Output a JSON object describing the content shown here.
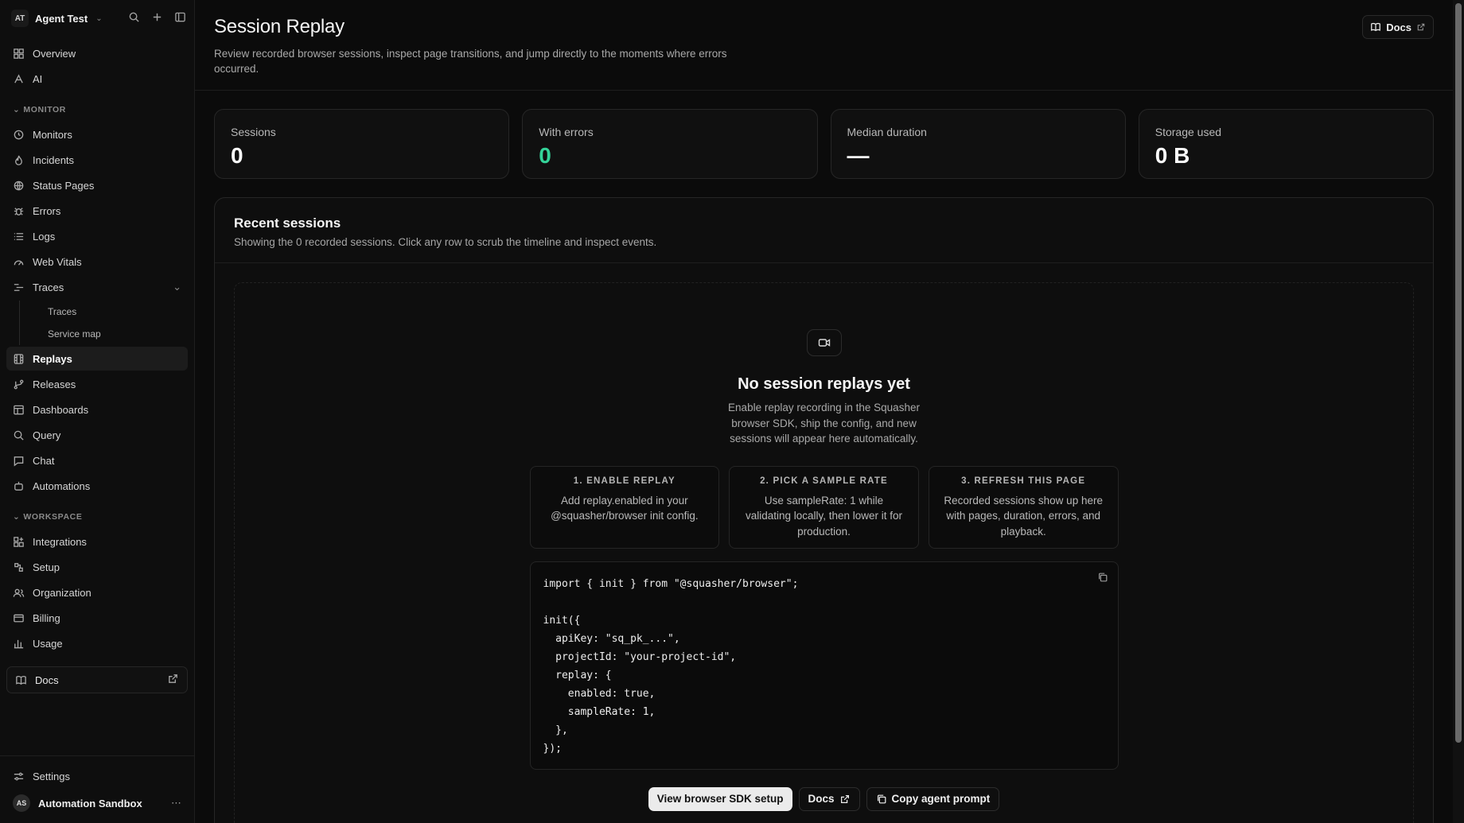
{
  "workspace": {
    "initials": "AT",
    "name": "Agent Test"
  },
  "nav": {
    "top": [
      {
        "label": "Overview",
        "icon": "overview-icon"
      },
      {
        "label": "AI",
        "icon": "ai-icon"
      }
    ],
    "monitor_label": "MONITOR",
    "monitor": [
      {
        "label": "Monitors"
      },
      {
        "label": "Incidents"
      },
      {
        "label": "Status Pages"
      },
      {
        "label": "Errors"
      },
      {
        "label": "Logs"
      },
      {
        "label": "Web Vitals"
      },
      {
        "label": "Traces"
      }
    ],
    "traces_sub": [
      "Traces",
      "Service map"
    ],
    "monitor2": [
      {
        "label": "Replays",
        "active": true
      },
      {
        "label": "Releases"
      },
      {
        "label": "Dashboards"
      },
      {
        "label": "Query"
      },
      {
        "label": "Chat"
      },
      {
        "label": "Automations"
      }
    ],
    "workspace_label": "WORKSPACE",
    "workspace": [
      {
        "label": "Integrations"
      },
      {
        "label": "Setup"
      },
      {
        "label": "Organization"
      },
      {
        "label": "Billing"
      },
      {
        "label": "Usage"
      }
    ],
    "docs": "Docs",
    "settings": "Settings"
  },
  "user": {
    "initials": "AS",
    "name": "Automation Sandbox"
  },
  "header": {
    "title": "Session Replay",
    "description": "Review recorded browser sessions, inspect page transitions, and jump directly to the moments where errors occurred.",
    "docs_label": "Docs"
  },
  "stats": [
    {
      "label": "Sessions",
      "value": "0"
    },
    {
      "label": "With errors",
      "value": "0",
      "color": "#34d399"
    },
    {
      "label": "Median duration",
      "value": "—"
    },
    {
      "label": "Storage used",
      "value": "0 B"
    }
  ],
  "recent": {
    "title": "Recent sessions",
    "description": "Showing the 0 recorded sessions. Click any row to scrub the timeline and inspect events."
  },
  "empty": {
    "title": "No session replays yet",
    "description": "Enable replay recording in the Squasher browser SDK, ship the config, and new sessions will appear here automatically.",
    "steps": [
      {
        "head": "1. ENABLE REPLAY",
        "body": "Add replay.enabled in your @squasher/browser init config."
      },
      {
        "head": "2. PICK A SAMPLE RATE",
        "body": "Use sampleRate: 1 while validating locally, then lower it for production."
      },
      {
        "head": "3. REFRESH THIS PAGE",
        "body": "Recorded sessions show up here with pages, duration, errors, and playback."
      }
    ],
    "code": "import { init } from \"@squasher/browser\";\n\ninit({\n  apiKey: \"sq_pk_...\",\n  projectId: \"your-project-id\",\n  replay: {\n    enabled: true,\n    sampleRate: 1,\n  },\n});",
    "actions": {
      "sdk_setup": "View browser SDK setup",
      "docs": "Docs",
      "copy_prompt": "Copy agent prompt"
    }
  }
}
